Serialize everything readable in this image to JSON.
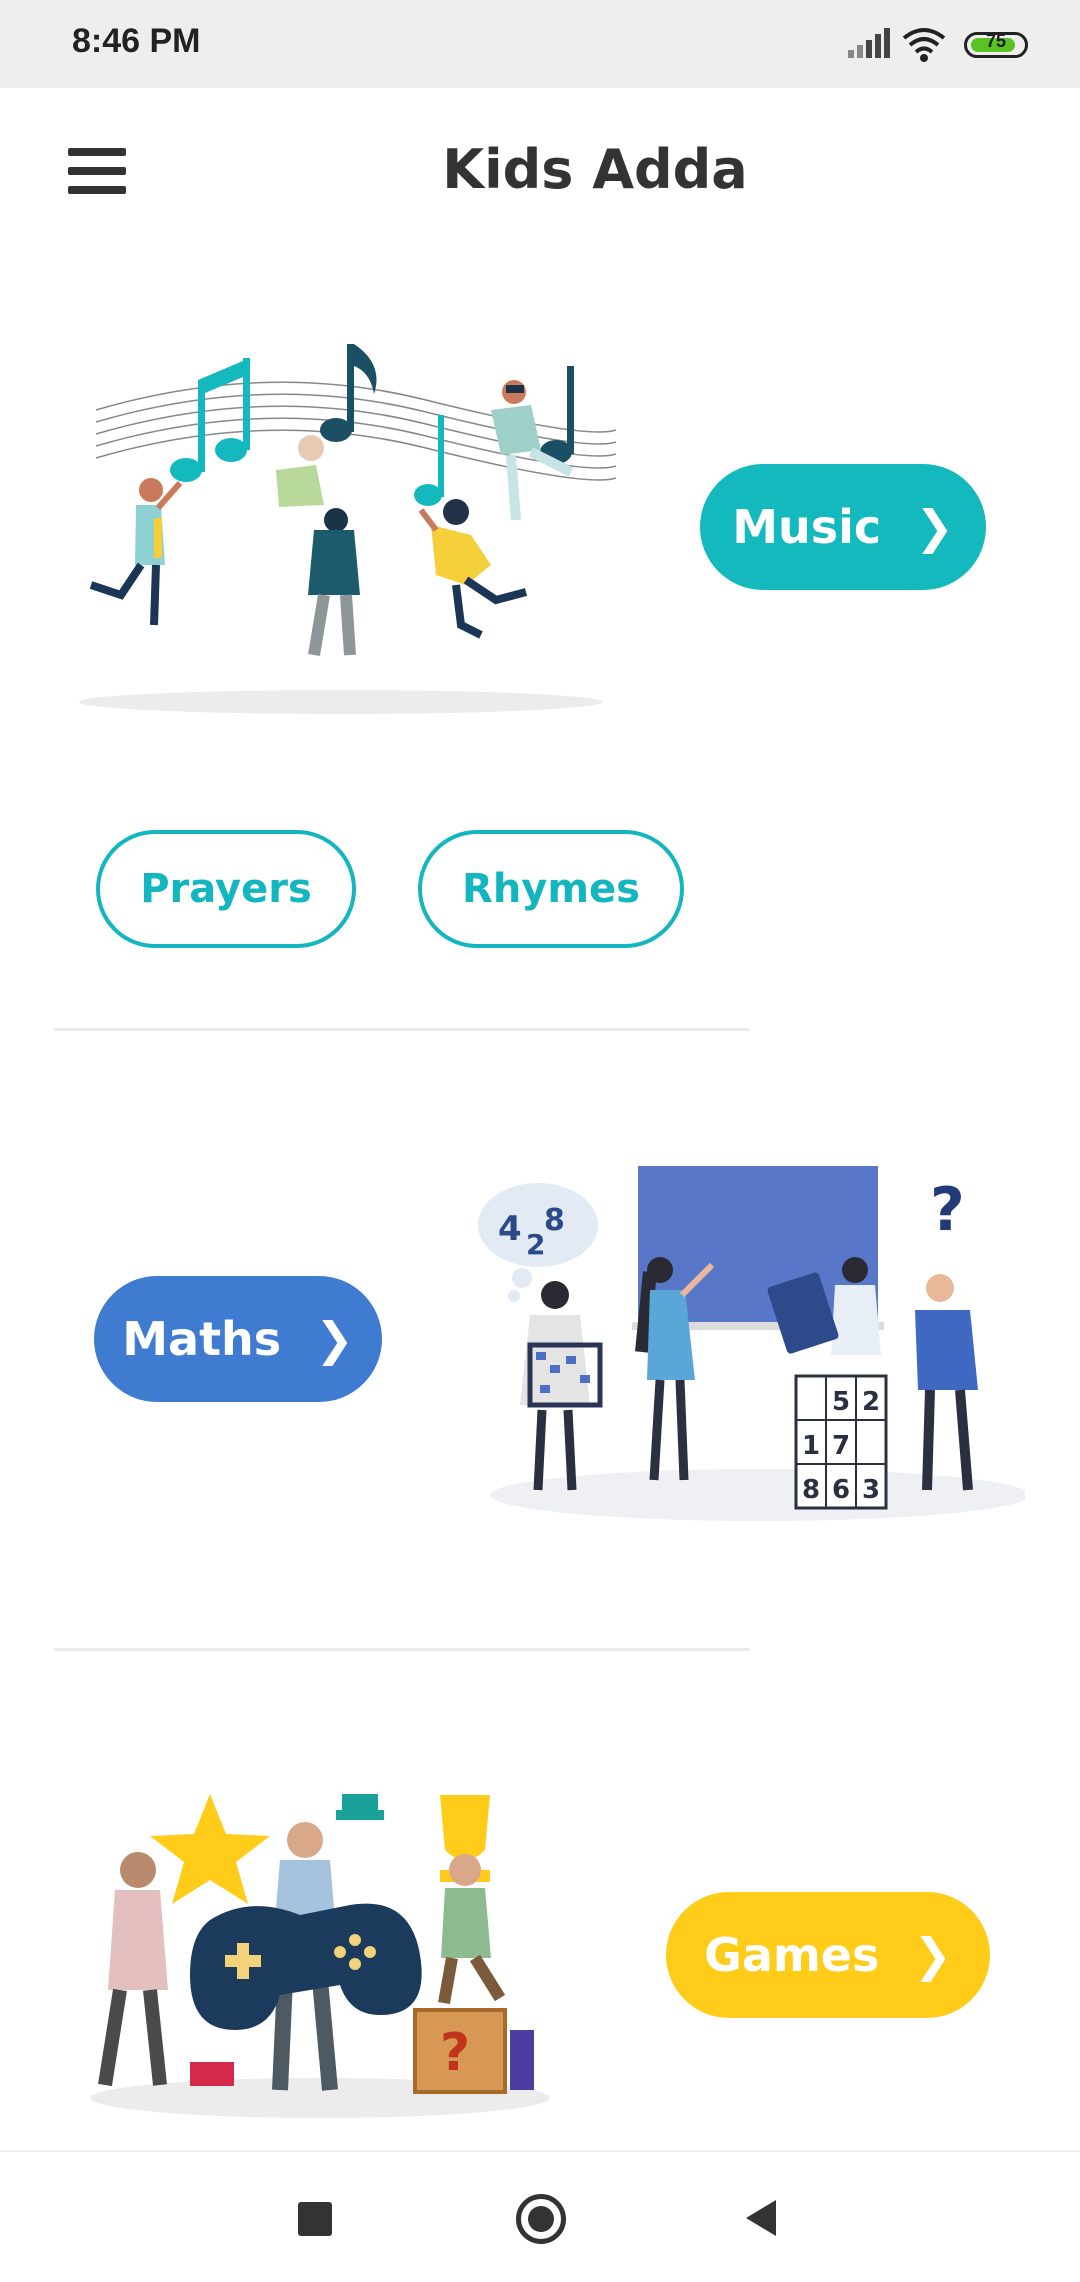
{
  "status_bar": {
    "time": "8:46 PM",
    "battery_level": "75",
    "icons": [
      "signal-icon",
      "wifi-icon",
      "battery-icon"
    ]
  },
  "app_bar": {
    "title": "Kids Adda",
    "menu_icon": "hamburger-menu-icon"
  },
  "sections": {
    "music": {
      "label": "Music",
      "color": "#13b9bd",
      "illustration": "dancing-people-music-notes",
      "sub_buttons": [
        "Prayers",
        "Rhymes"
      ]
    },
    "maths": {
      "label": "Maths",
      "color": "#3f7bd0",
      "illustration": "kids-learning-math-blackboard",
      "illustration_numbers": [
        "4",
        "2",
        "8",
        "5",
        "2",
        "1",
        "7",
        "8",
        "6",
        "3"
      ]
    },
    "games": {
      "label": "Games",
      "color": "#ffcc1a",
      "illustration": "people-gamepad-trophy"
    }
  },
  "nav_bar": {
    "icons": [
      "recent-apps-icon",
      "home-icon",
      "back-icon"
    ]
  }
}
